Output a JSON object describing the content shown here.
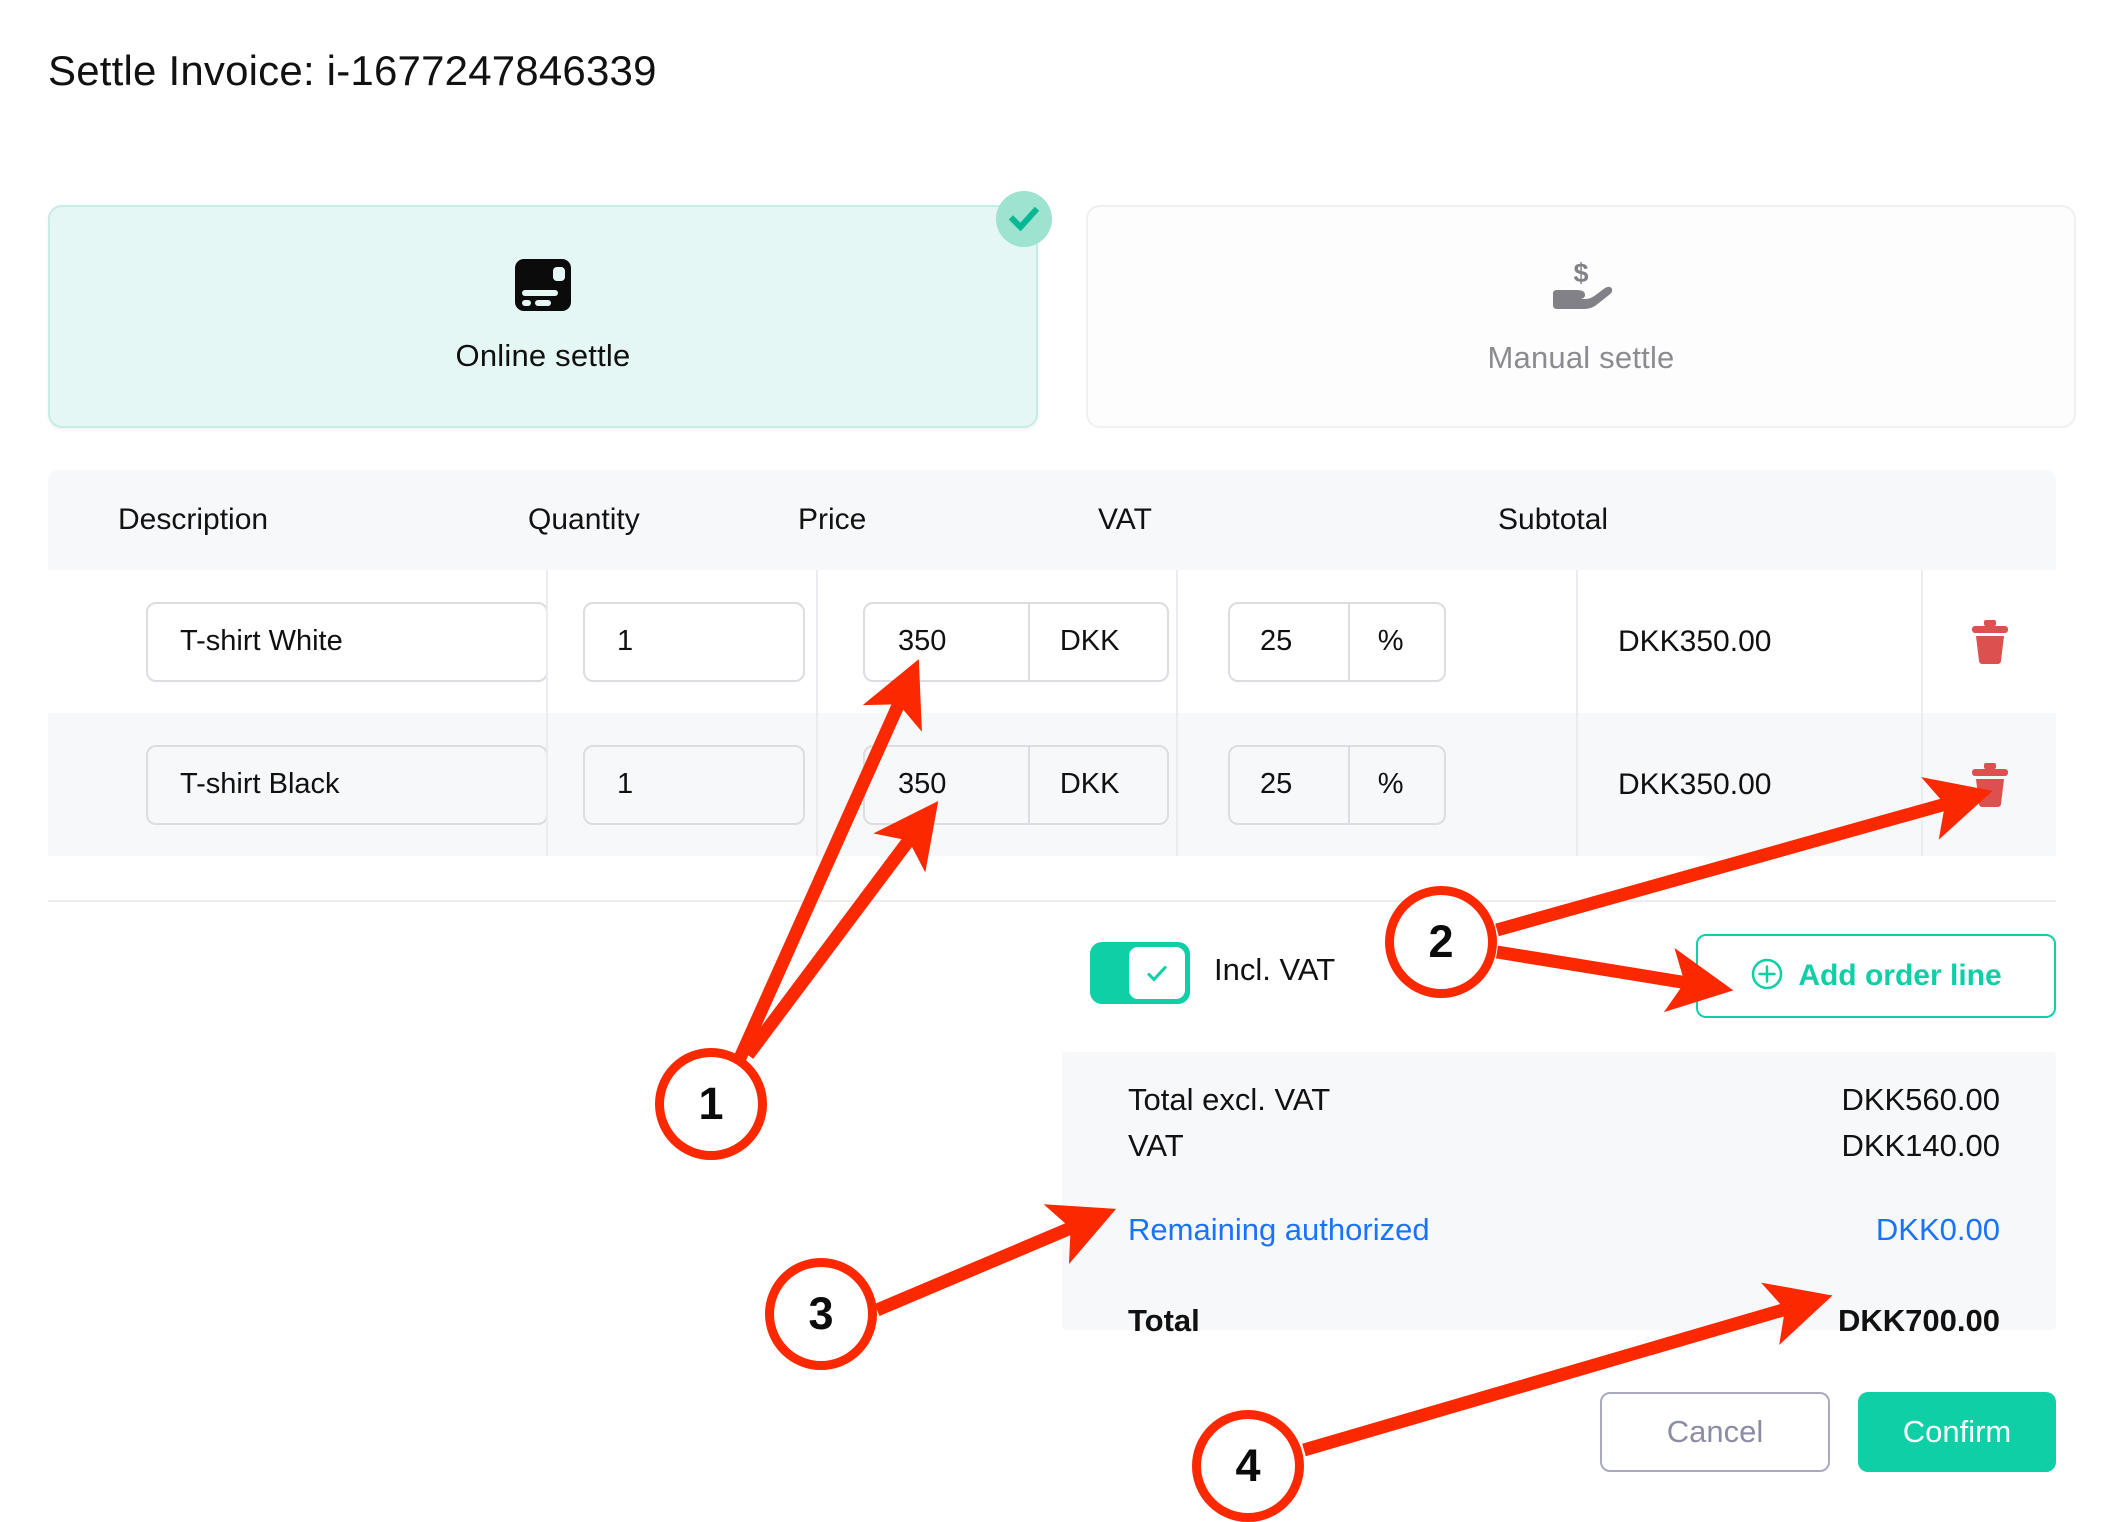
{
  "page": {
    "title": "Settle Invoice: i-1677247846339"
  },
  "methods": [
    {
      "id": "online",
      "label": "Online settle",
      "icon": "credit-card-icon",
      "selected": true
    },
    {
      "id": "manual",
      "label": "Manual settle",
      "icon": "hand-money-icon",
      "selected": false
    }
  ],
  "table": {
    "headers": [
      "Description",
      "Quantity",
      "Price",
      "VAT",
      "Subtotal"
    ],
    "rows": [
      {
        "description": "T-shirt White",
        "quantity": "1",
        "price": "350",
        "currency": "DKK",
        "vat": "25",
        "vat_unit": "%",
        "subtotal": "DKK350.00",
        "delete_icon": "trash-icon"
      },
      {
        "description": "T-shirt Black",
        "quantity": "1",
        "price": "350",
        "currency": "DKK",
        "vat": "25",
        "vat_unit": "%",
        "subtotal": "DKK350.00",
        "delete_icon": "trash-icon"
      }
    ]
  },
  "controls": {
    "incl_vat_label": "Incl. VAT",
    "incl_vat_on": true,
    "add_order_line_label": "Add order line",
    "add_order_line_icon": "circle-plus-icon"
  },
  "summary": [
    {
      "key": "Total excl. VAT",
      "value": "DKK560.00",
      "style": "normal"
    },
    {
      "key": "VAT",
      "value": "DKK140.00",
      "style": "normal"
    },
    {
      "key": "Remaining authorized",
      "value": "DKK0.00",
      "style": "link"
    },
    {
      "key": "Total",
      "value": "DKK700.00",
      "style": "bold"
    }
  ],
  "footer": {
    "cancel_label": "Cancel",
    "confirm_label": "Confirm"
  },
  "annotations": [
    {
      "number": "1"
    },
    {
      "number": "2"
    },
    {
      "number": "3"
    },
    {
      "number": "4"
    }
  ],
  "colors": {
    "accent_teal": "#0ecfa6",
    "card_selected_bg": "#e5f7f4",
    "link_blue": "#1a73ff",
    "annotation_red": "#fb2800",
    "trash_red": "#dc5050",
    "row_alt_bg": "#f7f8fa"
  }
}
